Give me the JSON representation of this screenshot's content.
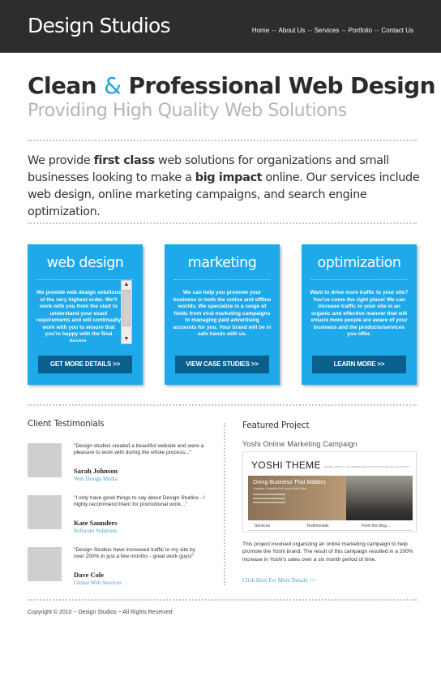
{
  "header": {
    "logo": "Design Studios",
    "nav": [
      "Home",
      "About Us",
      "Services",
      "Portfolio",
      "Contact Us"
    ],
    "nav_separator": "--"
  },
  "hero": {
    "headline_part1": "Clean",
    "headline_amp": "&",
    "headline_part2": "Professional Web Design",
    "subline": "Providing High Quality Web Solutions"
  },
  "intro": {
    "text1": "We provide ",
    "bold1": "first class",
    "text2": " web solutions for organizations and small businesses looking to make a ",
    "bold2": "big impact",
    "text3": " online. Our services include web design, online marketing campaigns, and search engine optimization."
  },
  "services": [
    {
      "title": "web design",
      "text": "We provide web design solutions of the very highest order. We'll work with you from the start to understand your exact requirements and will continually work with you to ensure that you're happy with the final design.",
      "button": "GET MORE DETAILS >>"
    },
    {
      "title": "marketing",
      "text": "We can help you promote your business in both the online and offline worlds. We specialize in a range of fields from viral marketing campaigns to managing paid advertising accounts for you. Your brand will be in safe hands with us.",
      "button": "VIEW CASE STUDIES >>"
    },
    {
      "title": "optimization",
      "text": "Want to drive more traffic to your site? You've come the right place! We can increase traffic to your site in an organic and effective manner that will ensure more people are aware of your business and the products/services you offer.",
      "button": "LEARN MORE >>"
    }
  ],
  "testimonials": {
    "heading": "Client Testimonials",
    "items": [
      {
        "quote": "\"Design studios created a beautiful website and were a pleasure to work with during the whole process...\"",
        "name": "Sarah Johnson",
        "org": "Web Design Media"
      },
      {
        "quote": "\"I only have good things to say about Design Studios - I highly recommend them for promotional work...\"",
        "name": "Kate Saunders",
        "org": "Software Solutions"
      },
      {
        "quote": "\"Design Studios have increased traffic to my site by over 200% in just a few months - great work guys!\"",
        "name": "Dave Cole",
        "org": "Global Web Services"
      }
    ]
  },
  "featured": {
    "heading": "Featured Project",
    "title": "Yoshi Online Marketing Campaign",
    "screenshot": {
      "logo": "YOSHI THEME",
      "nav": "HOME   ABOUT US   SERVICES   PRODUCTS   BLOG   CONTACT",
      "banner_title": "Doing Business That Matters",
      "banner_sub": "Curabitur Convallis Sed Lorem Nulla Vitae",
      "tabs": [
        "Services",
        "Testimonials",
        "From the blog..."
      ]
    },
    "description": "This project involved organizing an online marketing campaign to help promote the Yoshi brand. The result of this campaign resulted in a 200% increase in Yoshi's sales over a six month period of time.",
    "link": "Click Here For More Details >>"
  },
  "footer": {
    "copyright": "Copyright © 2010 ~ Design Studios ~ All Rights Reserved"
  },
  "colors": {
    "accent": "#1ea9ea",
    "button": "#0b5f8c",
    "header_bg": "#2d2d2d",
    "link": "#4a9fd8"
  }
}
